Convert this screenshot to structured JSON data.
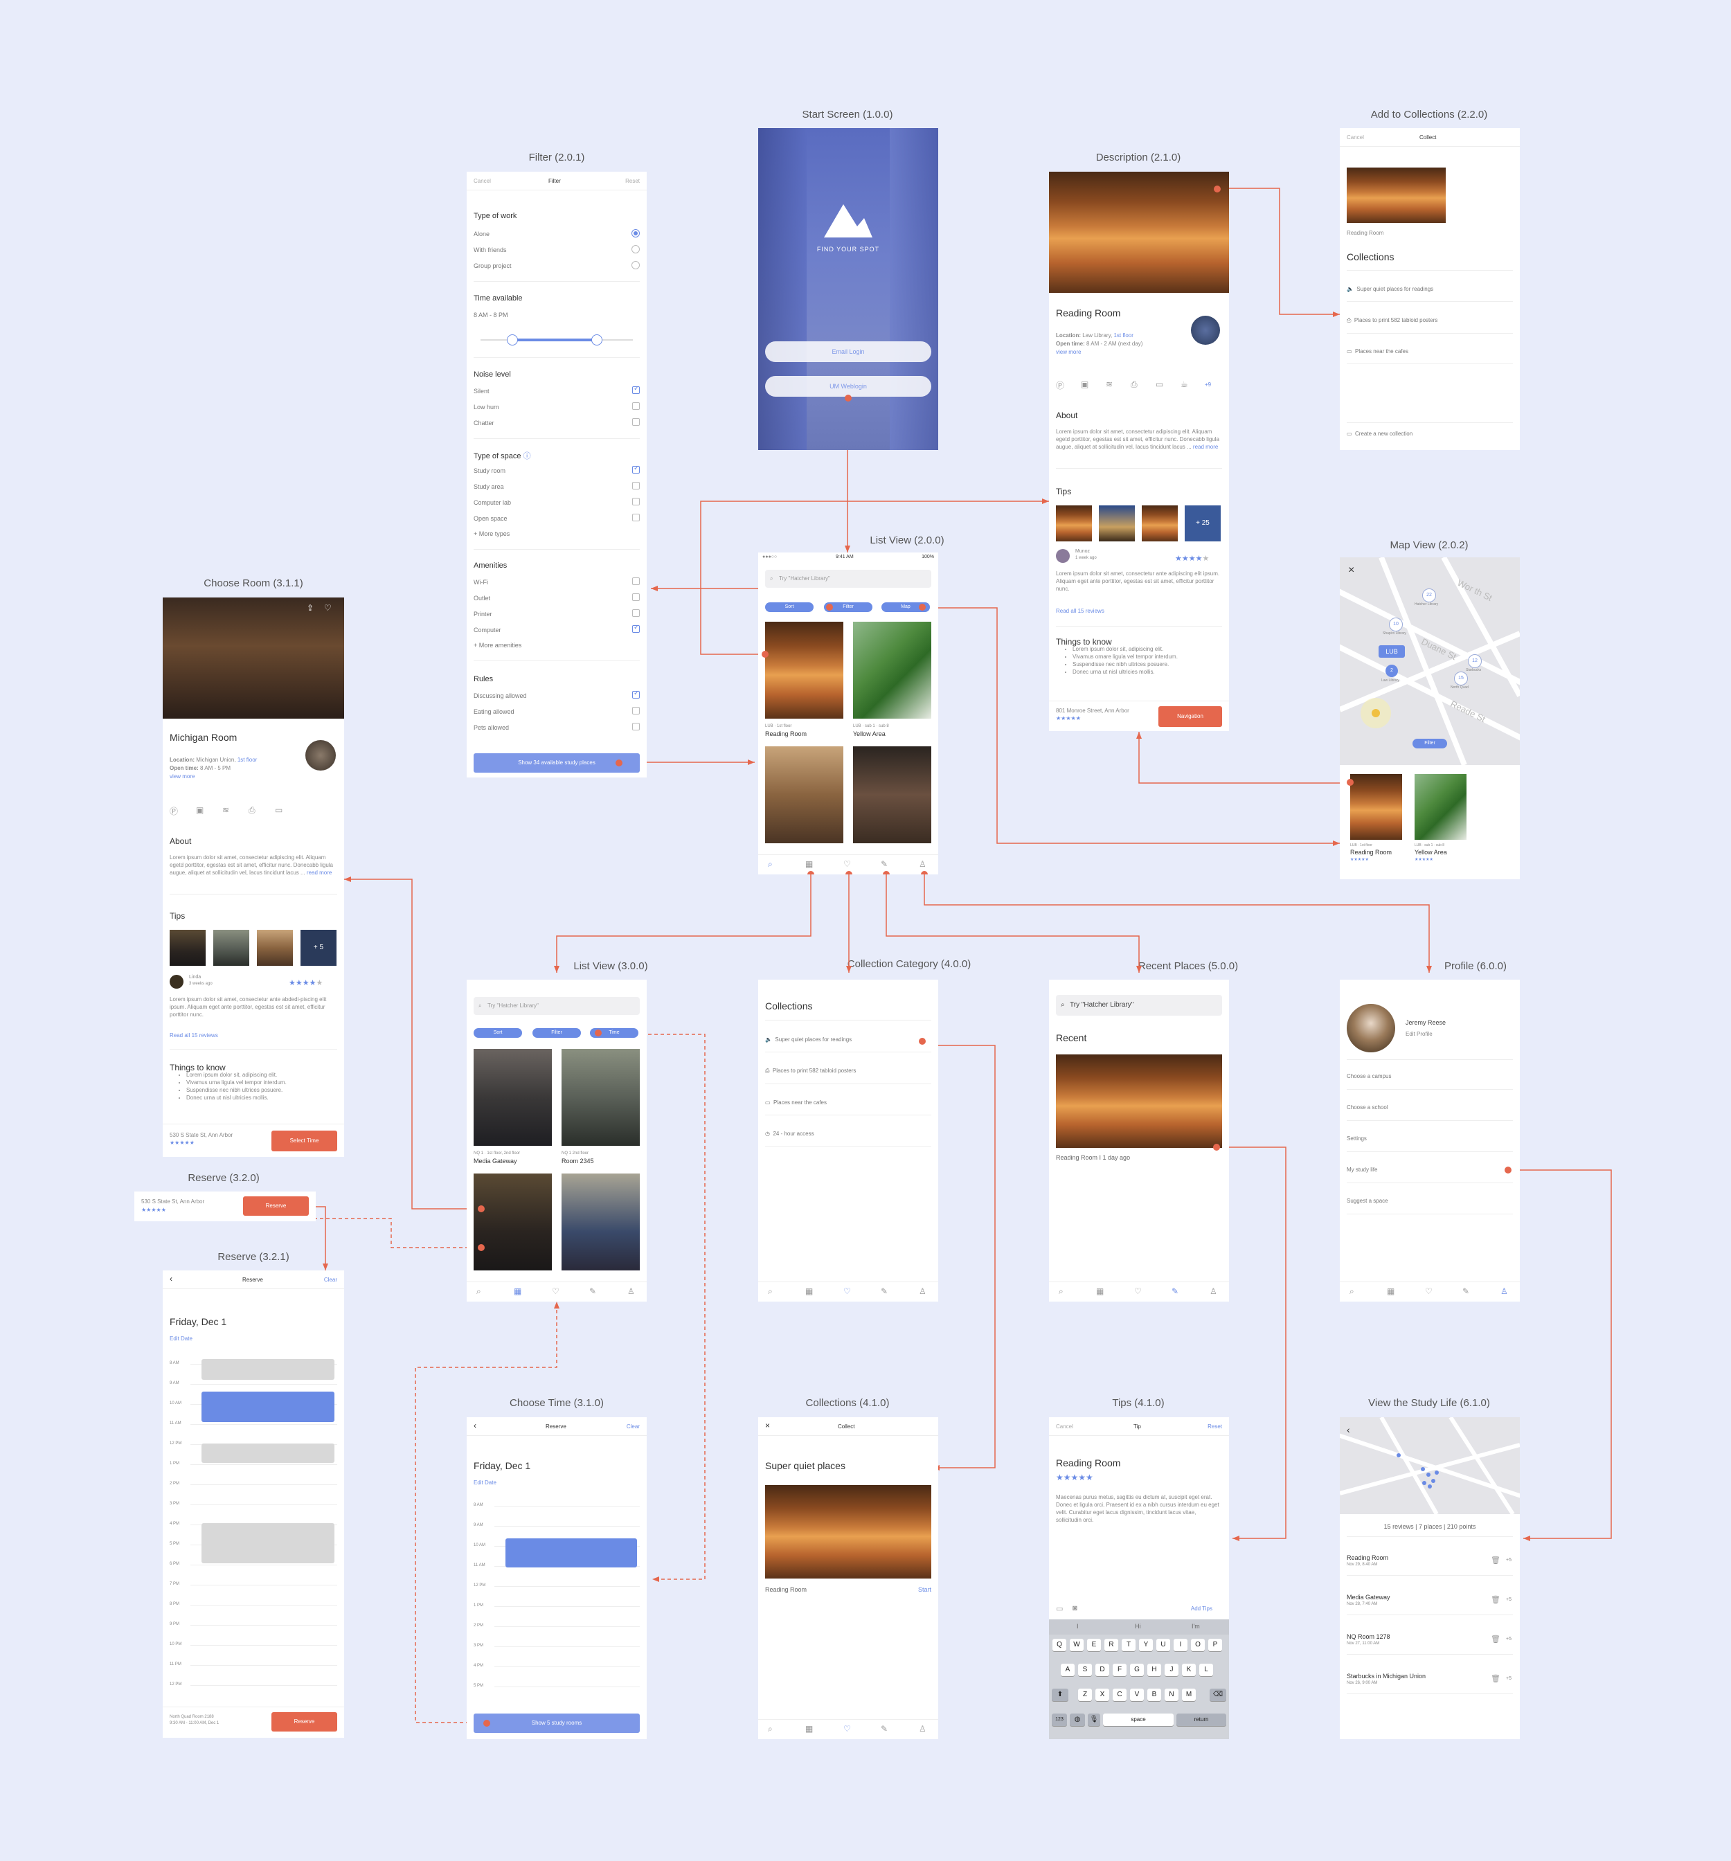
{
  "labels": {
    "start": "Start Screen (1.0.0)",
    "filter": "Filter (2.0.1)",
    "description": "Description (2.1.0)",
    "add_coll": "Add to Collections (2.2.0)",
    "list200": "List View (2.0.0)",
    "map": "Map View (2.0.2)",
    "choose_room": "Choose Room (3.1.1)",
    "list300": "List View (3.0.0)",
    "coll_cat": "Collection Category (4.0.0)",
    "recent": "Recent Places (5.0.0)",
    "profile": "Profile (6.0.0)",
    "reserve320": "Reserve (3.2.0)",
    "reserve321": "Reserve (3.2.1)",
    "choose_time": "Choose Time (3.1.0)",
    "coll410": "Collections (4.1.0)",
    "tips410": "Tips (4.1.0)",
    "study_life": "View the Study Life (6.1.0)"
  },
  "start": {
    "brand": "FIND YOUR SPOT",
    "email_btn": "Email Login",
    "um_btn": "UM Weblogin"
  },
  "filter": {
    "cancel": "Cancel",
    "title": "Filter",
    "reset": "Reset",
    "work_title": "Type of work",
    "work": [
      "Alone",
      "With friends",
      "Group project"
    ],
    "time_title": "Time available",
    "time_range": "8 AM - 8 PM",
    "noise_title": "Noise level",
    "noise": [
      "Silent",
      "Low hum",
      "Chatter"
    ],
    "space_title": "Type of space",
    "space": [
      "Study room",
      "Study area",
      "Computer lab",
      "Open space"
    ],
    "more_types": "+ More types",
    "amen_title": "Amenities",
    "amen": [
      "Wi-Fi",
      "Outlet",
      "Printer",
      "Computer"
    ],
    "more_amen": "+ More amenities",
    "rules_title": "Rules",
    "rules": [
      "Discussing allowed",
      "Eating allowed",
      "Pets allowed"
    ],
    "show_btn": "Show 34 available study places"
  },
  "desc": {
    "title": "Reading Room",
    "loc_label": "Location:",
    "loc": "Law Library,",
    "floor": "1st floor",
    "open_label": "Open time:",
    "open": "8 AM - 2 AM (next day)",
    "view_more": "view more",
    "plus": "+9",
    "about_title": "About",
    "about": "Lorem ipsum dolor sit amet, consectetur adipiscing elit. Aliquam egetd porttitor, egestas est sit amet, efficitur nunc. Donecabb ligula augue, aliquet at sollicitudin vel, lacus tincidunt lacus ...",
    "read_more": "read more",
    "tips_title": "Tips",
    "tips_more": "+ 25",
    "reviewer": "Munoz",
    "review_ago": "1 week ago",
    "review": "Lorem ipsum dolor sit amet, consectetur ante adipiscing elit ipsum. Aliquam eget ante porttitor, egestas est sit amet, efficitur porttitor nunc.",
    "read_all": "Read all 15 reviews",
    "know_title": "Things to know",
    "know": [
      "Lorem ipsum dolor sit, adipiscing elit.",
      "Vivamus ornare ligula vel tempor interdum.",
      "Suspendisse nec nibh ultrices posuere.",
      "Donec urna ut nisl ultricies mollis."
    ],
    "address": "801 Monroe Street, Ann Arbor",
    "stars": "★★★★★",
    "nav_btn": "Navigation"
  },
  "addcoll": {
    "cancel": "Cancel",
    "title": "Collect",
    "caption": "Reading Room",
    "coll_title": "Collections",
    "items": [
      "Super quiet places for readings",
      "Places to print 582 tabloid posters",
      "Places near the cafes"
    ],
    "create": "Create a new collection"
  },
  "list200": {
    "time": "9:41 AM",
    "battery": "100%",
    "search": "Try \"Hatcher Library\"",
    "sort": "Sort",
    "filter": "Filter",
    "map": "Map",
    "cards": [
      {
        "meta": "LUB · 1st floor",
        "name": "Reading Room"
      },
      {
        "meta": "LUB · sub 1 · sub 8",
        "name": "Yellow Area"
      }
    ]
  },
  "map": {
    "close": "×",
    "pin_lub": "LUB",
    "streets": [
      "Wor th St",
      "Duane St",
      "Reade St"
    ],
    "filter": "Filter",
    "num1": "22",
    "num2": "10",
    "num3": "2",
    "num4": "12",
    "num5": "15",
    "pl1": "Hatcher Library",
    "pl2": "Shapiro Library",
    "pl3": "Law Library",
    "pl4": "Starbucks",
    "pl5": "North Quad",
    "cards": [
      {
        "meta": "LUB · 1st floor",
        "name": "Reading Room",
        "stars": "★★★★★"
      },
      {
        "meta": "LUB · sub 1 · sub 8",
        "name": "Yellow Area",
        "stars": "★★★★★"
      }
    ]
  },
  "room": {
    "title": "Michigan Room",
    "loc_label": "Location:",
    "loc": "Michigan Union,",
    "floor": "1st floor",
    "open_label": "Open time:",
    "open": "8 AM - 5 PM",
    "view_more": "view more",
    "about_title": "About",
    "about": "Lorem ipsum dolor sit amet, consectetur adipiscing elit. Aliquam egetd porttitor, egestas est sit amet, efficitur nunc. Donecabb ligula augue, aliquet at sollicitudin vel, lacus tincidunt lacus ...",
    "read_more": "read more",
    "tips_title": "Tips",
    "tips_more": "+ 5",
    "reviewer": "Linda",
    "review_ago": "3 weeks ago",
    "review": "Lorem ipsum dolor sit amet, consectetur ante abdedi-piscing elit ipsum. Aliquam eget ante porttitor, egestas est sit amet, efficitur porttitor nunc.",
    "read_all": "Read all 15 reviews",
    "know_title": "Things to know",
    "know": [
      "Lorem ipsum dolor sit, adipiscing elit.",
      "Vivamus urna ligula vel tempor interdum.",
      "Suspendisse nec nibh ultrices posuere.",
      "Donec urna ut nisl ultricies mollis."
    ],
    "address": "530 S State St, Ann Arbor",
    "stars": "★★★★★",
    "select_btn": "Select Time"
  },
  "reserve320": {
    "address": "530 S State St, Ann Arbor",
    "stars": "★★★★★",
    "btn": "Reserve"
  },
  "reserve321": {
    "title": "Reserve",
    "clear": "Clear",
    "date": "Friday, Dec 1",
    "edit": "Edit Date",
    "times": [
      "8 AM",
      "9 AM",
      "10 AM",
      "11 AM",
      "12 PM",
      "1 PM",
      "2 PM",
      "3 PM",
      "4 PM",
      "5 PM",
      "6 PM",
      "7 PM",
      "8 PM",
      "9 PM",
      "10 PM",
      "11 PM",
      "12 PM"
    ],
    "foot1": "North Quad Room 2188",
    "foot2": "9:30 AM - 11:00 AM, Dec 1",
    "btn": "Reserve"
  },
  "list300": {
    "search": "Try \"Hatcher Library\"",
    "sort": "Sort",
    "filter": "Filter",
    "time": "Time",
    "cards": [
      {
        "meta": "NQ 1 · 1st floor, 2nd floor",
        "name": "Media Gateway"
      },
      {
        "meta": "NQ 1 2nd floor",
        "name": "Room 2345"
      }
    ]
  },
  "collcat": {
    "title": "Collections",
    "items": [
      "Super quiet places for readings",
      "Places to print 582 tabloid posters",
      "Places near the cafes",
      "24 - hour access"
    ]
  },
  "recent": {
    "search": "Try \"Hatcher Library\"",
    "title": "Recent",
    "caption": "Reading Room I 1 day ago"
  },
  "profile": {
    "name": "Jeremy Reese",
    "edit": "Edit Profile",
    "items": [
      "Choose a campus",
      "Choose a school",
      "Settings",
      "My study life",
      "Suggest a space"
    ]
  },
  "ctime": {
    "title": "Reserve",
    "clear": "Clear",
    "date": "Friday, Dec 1",
    "edit": "Edit Date",
    "times": [
      "8 AM",
      "9 AM",
      "10 AM",
      "11 AM",
      "12 PM",
      "1 PM",
      "2 PM",
      "3 PM",
      "4 PM",
      "5 PM"
    ],
    "btn": "Show 5 study rooms"
  },
  "coll410": {
    "title": "Collect",
    "heading": "Super quiet places",
    "caption": "Reading Room",
    "start": "Start"
  },
  "tips410": {
    "cancel": "Cancel",
    "title": "Tip",
    "reset": "Reset",
    "heading": "Reading Room",
    "stars": "★★★★★",
    "body": "Maecenas purus metus, sagittis eu dictum at, suscipit eget erat. Donec et ligula orci. Praesent id ex a nibh cursus interdum eu eget velit. Curabitur eget lacus dignissim, tincidunt lacus vitae, sollicitudin orci.",
    "add": "Add Tips",
    "suggest": [
      "I",
      "Hi",
      "I'm"
    ],
    "row1": [
      "Q",
      "W",
      "E",
      "R",
      "T",
      "Y",
      "U",
      "I",
      "O",
      "P"
    ],
    "row2": [
      "A",
      "S",
      "D",
      "F",
      "G",
      "H",
      "J",
      "K",
      "L"
    ],
    "row3": [
      "Z",
      "X",
      "C",
      "V",
      "B",
      "N",
      "M"
    ],
    "k123": "123",
    "space": "space",
    "return": "return"
  },
  "studylife": {
    "stats": "15 reviews | 7 places | 210 points",
    "items": [
      {
        "name": "Reading Room",
        "date": "Nov 29, 8:40 AM",
        "pts": "+5"
      },
      {
        "name": "Media Gateway",
        "date": "Nov 28, 7:40 AM",
        "pts": "+5"
      },
      {
        "name": "NQ Room 1278",
        "date": "Nov 27, 11:00 AM",
        "pts": "+5"
      },
      {
        "name": "Starbucks in Michigan Union",
        "date": "Nov 26, 9:00 AM",
        "pts": "+5"
      }
    ]
  },
  "colors": {
    "bg": "#E8ECFA",
    "accent": "#6A8BE5",
    "connector": "#E5674D"
  }
}
